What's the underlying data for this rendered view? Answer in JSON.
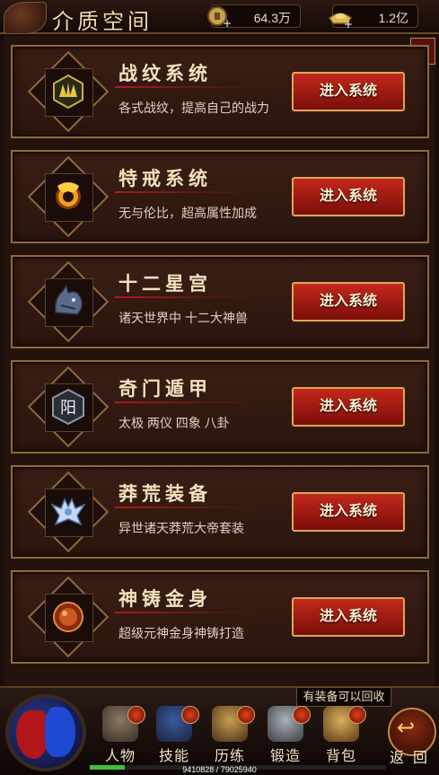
{
  "header": {
    "title": "介质空间",
    "resource_coins": "64.3万",
    "resource_ingots": "1.2亿",
    "close_symbol": "✕"
  },
  "systems": [
    {
      "title": "战纹系统",
      "desc": "各式战纹，提高自己的战力",
      "button": "进入系统",
      "icon": "battle-pattern-icon"
    },
    {
      "title": "特戒系统",
      "desc": "无与伦比，超高属性加成",
      "button": "进入系统",
      "icon": "special-ring-icon"
    },
    {
      "title": "十二星宫",
      "desc": "诸天世界中 十二大神兽",
      "button": "进入系统",
      "icon": "dragon-head-icon"
    },
    {
      "title": "奇门遁甲",
      "desc": "太极 两仪 四象 八卦",
      "button": "进入系统",
      "icon": "yang-seal-icon",
      "icon_text": "阳"
    },
    {
      "title": "莽荒装备",
      "desc": "异世诸天莽荒大帝套装",
      "button": "进入系统",
      "icon": "wild-armor-icon"
    },
    {
      "title": "神铸金身",
      "desc": "超级元神金身神铸打造",
      "button": "进入系统",
      "icon": "golden-body-icon"
    }
  ],
  "tooltip": "有装备可以回收",
  "bottom_nav": [
    {
      "label": "人物",
      "icon": "character-icon"
    },
    {
      "label": "技能",
      "icon": "skill-book-icon"
    },
    {
      "label": "历练",
      "icon": "training-icon"
    },
    {
      "label": "锻造",
      "icon": "forge-icon"
    },
    {
      "label": "背包",
      "icon": "bag-icon"
    }
  ],
  "back_label": "返回",
  "experience": {
    "text": "9410828 / 79025940",
    "fraction": 0.119
  },
  "colors": {
    "accent_red": "#b0161a",
    "gold_border": "#8c6a3c",
    "button_red": "#c4281c",
    "xp_green": "#3fbf3a"
  }
}
